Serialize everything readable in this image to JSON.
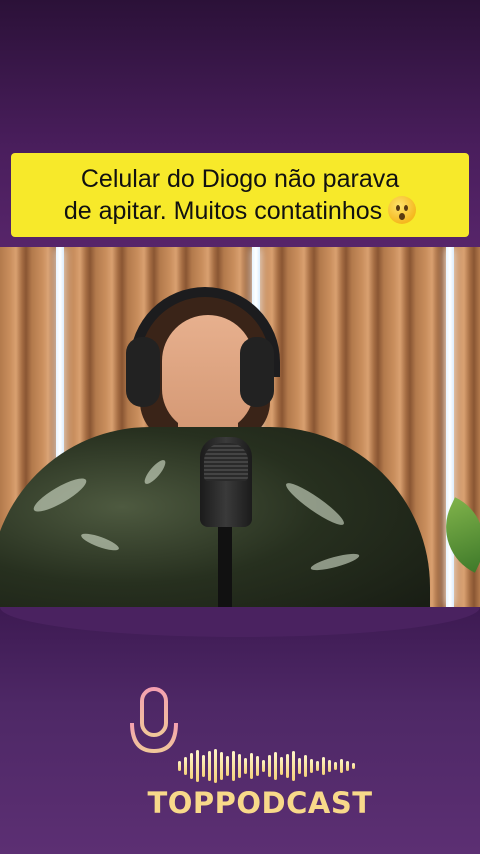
{
  "caption": {
    "line1": "Celular do Diogo não parava",
    "line2": "de apitar. Muitos contatinhos",
    "emoji": "hushed-face-icon"
  },
  "logo": {
    "name": "TOPPODCAST",
    "icon": "microphone-icon",
    "accent_color": "#f8d98a",
    "mic_color": "#f0a0a8"
  },
  "colors": {
    "background": "#3e1a4e",
    "caption_background": "#f7e92a"
  }
}
